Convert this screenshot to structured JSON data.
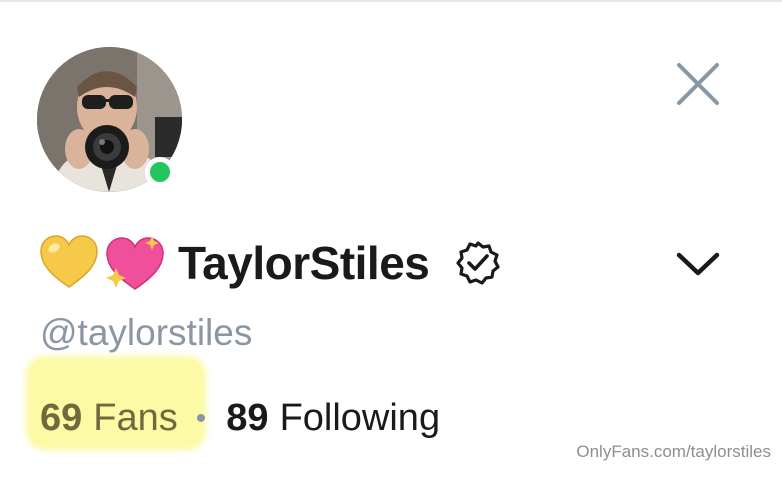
{
  "profile": {
    "display_name": "TaylorStiles",
    "handle": "@taylorstiles",
    "online": true,
    "emojis": [
      "yellow-heart",
      "sparkling-heart"
    ],
    "verified": true
  },
  "stats": {
    "fans_count": "69",
    "fans_label": "Fans",
    "separator": "•",
    "following_count": "89",
    "following_label": "Following"
  },
  "watermark": "OnlyFans.com/taylorstiles",
  "icons": {
    "close": "close-icon",
    "expand": "chevron-down-icon",
    "verified": "verified-badge-icon"
  },
  "colors": {
    "online": "#22c55e",
    "muted": "#8a96a3",
    "text": "#1a1a1a",
    "highlight": "#fcfaa4"
  }
}
